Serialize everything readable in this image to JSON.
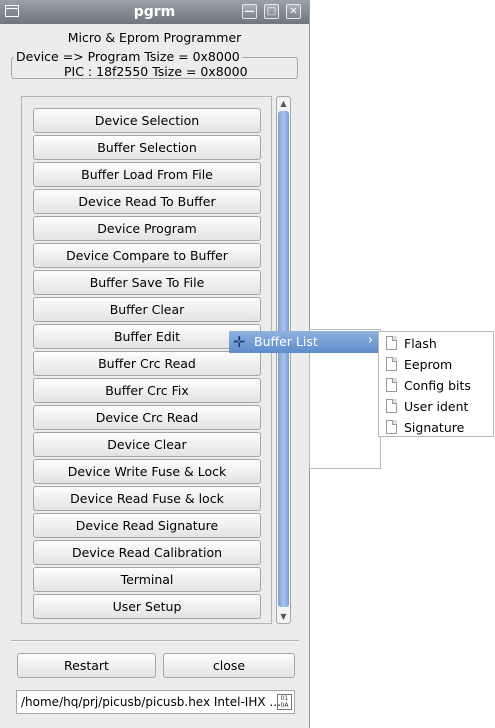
{
  "window": {
    "title": "pgrm",
    "controls": {
      "minimize": "—",
      "maximize": "□",
      "close": "✕"
    }
  },
  "heading": "Micro & Eprom Programmer",
  "device_group": {
    "legend": "Device => Program Tsize = 0x8000",
    "info": "PIC : 18f2550  Tsize = 0x8000"
  },
  "buttons": [
    "Device Selection",
    "Buffer Selection",
    "Buffer Load From File",
    "Device Read To Buffer",
    "Device Program",
    "Device Compare to Buffer",
    "Buffer Save To File",
    "Buffer Clear",
    "Buffer Edit",
    "Buffer Crc Read",
    "Buffer Crc Fix",
    "Device Crc Read",
    "Device Clear",
    "Device Write Fuse & Lock",
    "Device Read Fuse & lock",
    "Device Read Signature",
    "Device Read Calibration",
    "Terminal",
    "User Setup"
  ],
  "bottom_buttons": {
    "restart": "Restart",
    "close": "close"
  },
  "path_field": {
    "value": "/home/hq/prj/picusb/picusb.hex Intel-IHX ..."
  },
  "context_menu": {
    "item": "Buffer List",
    "submenu": [
      "Flash",
      "Eeprom",
      "Config bits",
      "User ident",
      "Signature"
    ]
  },
  "colors": {
    "highlight": "#5d8ccb",
    "scroll_thumb": "#7aa0d4"
  },
  "icons": {
    "window": "window-icon",
    "file": "document-icon",
    "pathbrowse": "file-browse-icon"
  }
}
